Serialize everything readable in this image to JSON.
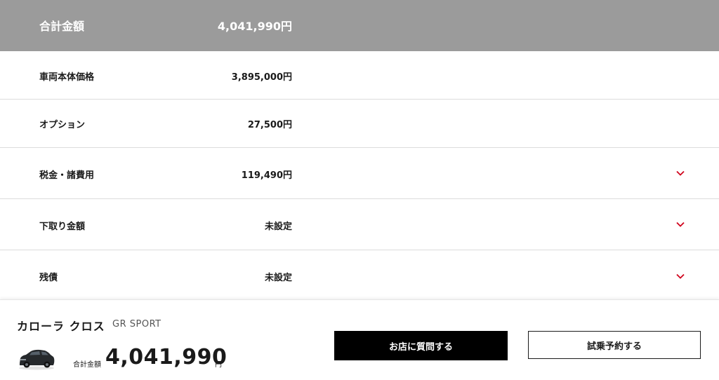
{
  "summary": {
    "label": "合計金額",
    "value": "4,041,990円"
  },
  "rows": [
    {
      "label": "車両本体価格",
      "value": "3,895,000円"
    },
    {
      "label": "オプション",
      "value": "27,500円"
    },
    {
      "label": "税金・諸費用",
      "value": "119,490円"
    },
    {
      "label": "下取り金額",
      "value": "未設定"
    },
    {
      "label": "残債",
      "value": "未設定"
    }
  ],
  "footer": {
    "model_name": "カローラ クロス",
    "grade": "GR SPORT",
    "total_label": "合計金額",
    "total_value": "4,041,990",
    "total_unit": "円",
    "ask_store_button": "お店に質問する",
    "test_drive_button": "試乗予約する"
  },
  "colors": {
    "header_bg": "#9b9b9b",
    "accent_chevron": "#d0021b",
    "primary_button": "#000000"
  }
}
